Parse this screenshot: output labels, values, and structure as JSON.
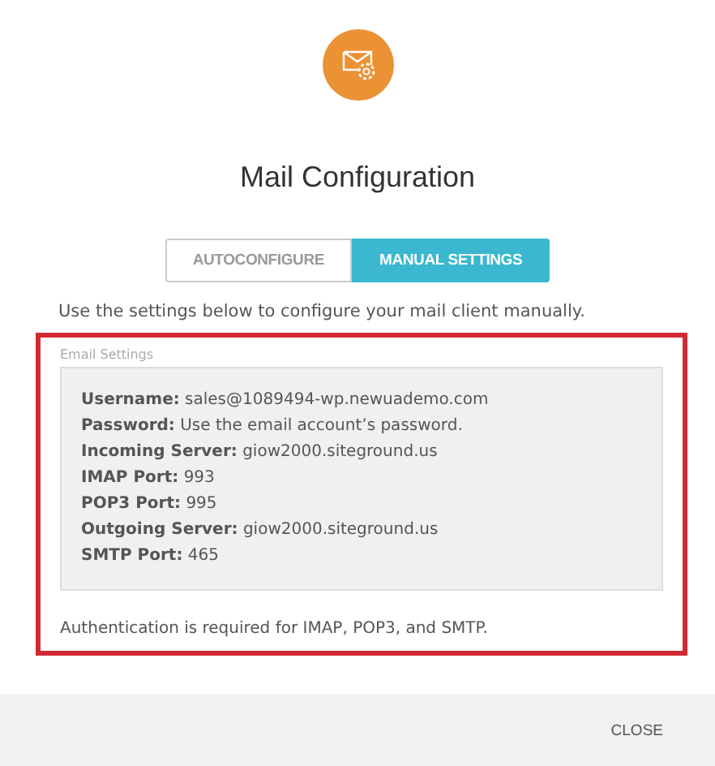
{
  "dialog": {
    "title": "Mail Configuration"
  },
  "tabs": [
    {
      "label": "AUTOCONFIGURE",
      "selected": false
    },
    {
      "label": "MANUAL SETTINGS",
      "selected": true
    }
  ],
  "intro": "Use the settings below to configure your mail client manually.",
  "settings": {
    "legend": "Email Settings",
    "highlighted": true,
    "lines": [
      "**Username:** sales@1089494-wp.newuademo.com",
      "**Password:** Use the email account’s password.",
      "**Incoming Server:** giow2000.siteground.us",
      "**IMAP Port:** 993",
      "**POP3 Port:** 995",
      "**Outgoing Server:** giow2000.siteground.us",
      "**SMTP Port:** 465"
    ],
    "note": "Authentication is required for IMAP, POP3, and SMTP."
  },
  "footer": {
    "button": "CLOSE"
  }
}
